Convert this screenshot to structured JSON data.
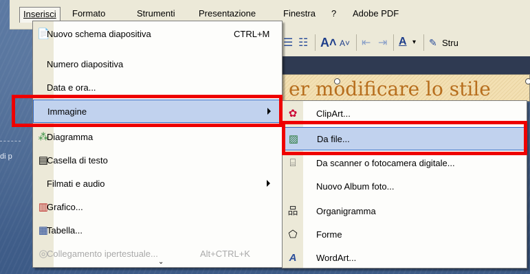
{
  "menubar": {
    "items": [
      {
        "label": "Inserisci"
      },
      {
        "label": "Formato"
      },
      {
        "label": "Strumenti"
      },
      {
        "label": "Presentazione"
      },
      {
        "label": "Finestra"
      },
      {
        "label": "?"
      },
      {
        "label": "Adobe PDF"
      }
    ]
  },
  "toolbar": {
    "stru_label": "Stru"
  },
  "slide": {
    "title_fragment": "er modificare lo stile",
    "bg_fragment": "di p"
  },
  "insert_menu": {
    "items": [
      {
        "label": "Nuovo schema diapositiva",
        "shortcut": "CTRL+M",
        "icon": "new-layout-icon"
      },
      {
        "label": "Numero diapositiva"
      },
      {
        "label": "Data e ora..."
      },
      {
        "label": "Immagine",
        "submenu": true
      },
      {
        "label": "Diagramma",
        "icon": "diagram-icon"
      },
      {
        "label": "Casella di testo",
        "icon": "textbox-icon"
      },
      {
        "label": "Filmati e audio",
        "submenu": true
      },
      {
        "label": "Grafico...",
        "icon": "chart-icon"
      },
      {
        "label": "Tabella...",
        "icon": "table-icon"
      },
      {
        "label": "Collegamento ipertestuale...",
        "shortcut": "Alt+CTRL+K",
        "disabled": true,
        "icon": "hyperlink-icon"
      }
    ]
  },
  "image_submenu": {
    "items": [
      {
        "label": "ClipArt...",
        "icon": "clipart-icon"
      },
      {
        "label": "Da file...",
        "icon": "picture-from-file-icon"
      },
      {
        "label": "Da scanner o fotocamera digitale...",
        "icon": "scanner-icon"
      },
      {
        "label": "Nuovo Album foto..."
      },
      {
        "label": "Organigramma",
        "icon": "org-chart-icon"
      },
      {
        "label": "Forme",
        "icon": "autoshapes-icon"
      },
      {
        "label": "WordArt...",
        "icon": "wordart-icon"
      }
    ]
  },
  "colors": {
    "highlight": "#ee0000",
    "selection": "#c1d2ee",
    "selection_border": "#316ac5",
    "menu_bg": "#ece9d8"
  }
}
